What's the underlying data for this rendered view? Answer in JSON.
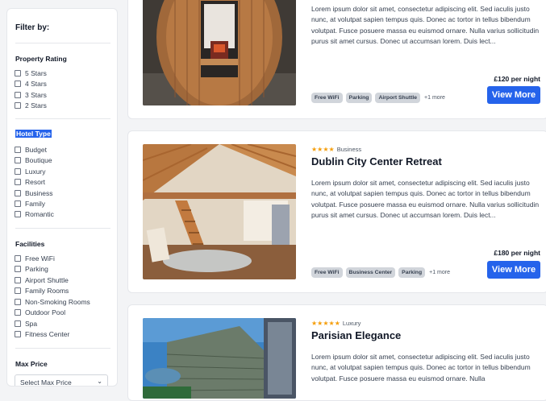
{
  "sidebar": {
    "title": "Filter by:",
    "rating": {
      "heading": "Property Rating",
      "options": [
        "5 Stars",
        "4 Stars",
        "3 Stars",
        "2 Stars"
      ]
    },
    "hotel_type": {
      "heading": "Hotel Type",
      "options": [
        "Budget",
        "Boutique",
        "Luxury",
        "Resort",
        "Business",
        "Family",
        "Romantic"
      ]
    },
    "facilities": {
      "heading": "Facilities",
      "options": [
        "Free WiFi",
        "Parking",
        "Airport Shuttle",
        "Family Rooms",
        "Non-Smoking Rooms",
        "Outdoor Pool",
        "Spa",
        "Fitness Center"
      ]
    },
    "max_price": {
      "heading": "Max Price",
      "value": "Select Max Price"
    }
  },
  "hotels": [
    {
      "name": "",
      "stars": 0,
      "category": "",
      "description": "Lorem ipsum dolor sit amet, consectetur adipiscing elit. Sed iaculis justo nunc, at volutpat sapien tempus quis. Donec ac tortor in tellus bibendum volutpat. Fusce posuere massa eu euismod ornare. Nulla varius sollicitudin purus sit amet cursus. Donec ut accumsan lorem. Duis lect...",
      "tags": [
        "Free WiFi",
        "Parking",
        "Airport Shuttle"
      ],
      "more": "+1 more",
      "price": "£120 per night",
      "button": "View More"
    },
    {
      "name": "Dublin City Center Retreat",
      "stars": 4,
      "category": "Business",
      "description": "Lorem ipsum dolor sit amet, consectetur adipiscing elit. Sed iaculis justo nunc, at volutpat sapien tempus quis. Donec ac tortor in tellus bibendum volutpat. Fusce posuere massa eu euismod ornare. Nulla varius sollicitudin purus sit amet cursus. Donec ut accumsan lorem. Duis lect...",
      "tags": [
        "Free WiFi",
        "Business Center",
        "Parking"
      ],
      "more": "+1 more",
      "price": "£180 per night",
      "button": "View More"
    },
    {
      "name": "Parisian Elegance",
      "stars": 5,
      "category": "Luxury",
      "description": "Lorem ipsum dolor sit amet, consectetur adipiscing elit. Sed iaculis justo nunc, at volutpat sapien tempus quis. Donec ac tortor in tellus bibendum volutpat. Fusce posuere massa eu euismod ornare. Nulla",
      "tags": [],
      "more": "",
      "price": "",
      "button": ""
    }
  ],
  "colors": {
    "accent": "#2563eb",
    "star": "#f59e0b",
    "tag_bg": "#d1d5db"
  },
  "icons": {
    "star": "star-icon",
    "chevron": "chevron-down-icon"
  }
}
